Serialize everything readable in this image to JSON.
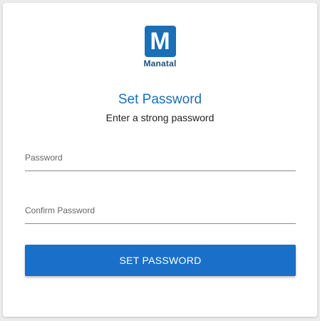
{
  "brand": {
    "logo_letter": "M",
    "name": "Manatal",
    "color": "#1a6fb7"
  },
  "form": {
    "title": "Set Password",
    "subtitle": "Enter a strong password",
    "password_placeholder": "Password",
    "confirm_password_placeholder": "Confirm Password",
    "submit_label": "SET PASSWORD",
    "button_color": "#1a6fc8"
  }
}
